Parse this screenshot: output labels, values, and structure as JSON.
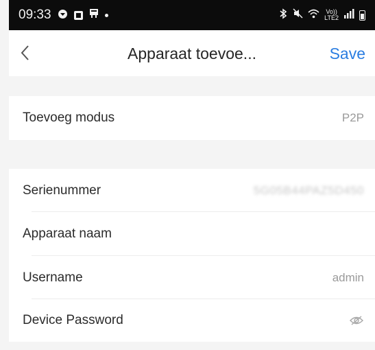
{
  "status_bar": {
    "time": "09:33",
    "lte_line1": "Vo))",
    "lte_line2": "LTE2",
    "icons": [
      "shield-icon",
      "gallery-icon",
      "sim-icon",
      "dot-icon",
      "bluetooth-icon",
      "mute-icon",
      "wifi-icon",
      "signal-icon",
      "battery-icon"
    ]
  },
  "nav": {
    "title": "Apparaat toevoe...",
    "save_label": "Save",
    "back_icon": "chevron-left-icon"
  },
  "form": {
    "mode": {
      "label": "Toevoeg modus",
      "value": "P2P"
    },
    "serial": {
      "label": "Serienummer",
      "value": "5G05B44PAZ5D450"
    },
    "name": {
      "label": "Apparaat naam",
      "value": ""
    },
    "username": {
      "label": "Username",
      "value": "admin"
    },
    "password": {
      "label": "Device Password",
      "icon": "eye-hidden-icon"
    }
  },
  "colors": {
    "accent": "#2a7de1",
    "background": "#f4f4f4",
    "status_bar": "#0c0c0c"
  }
}
